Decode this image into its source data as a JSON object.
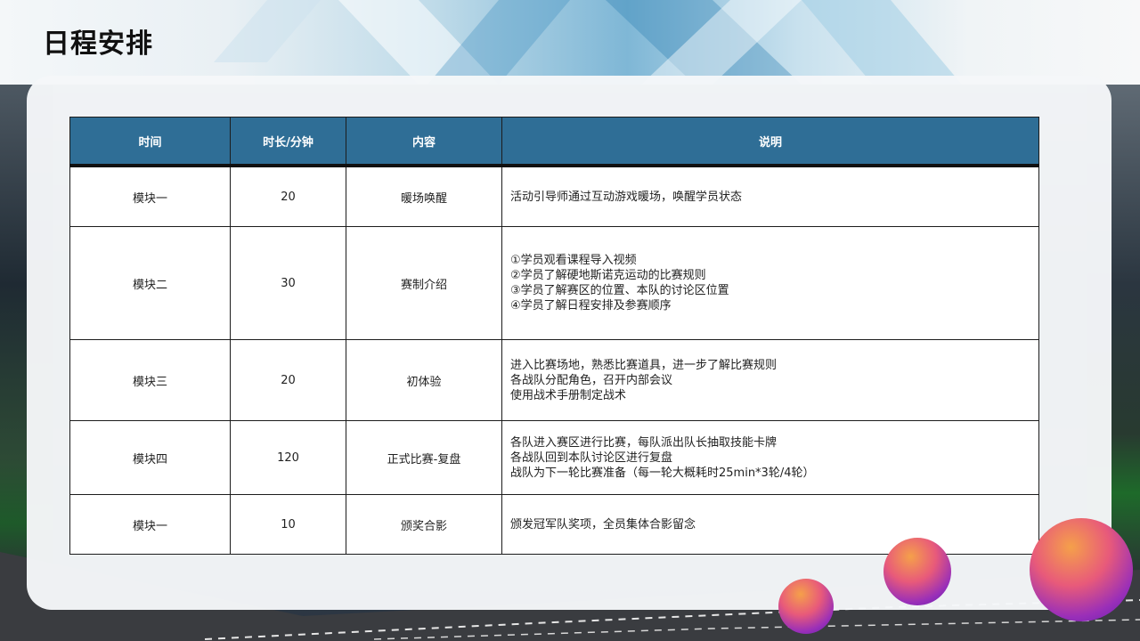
{
  "slide": {
    "title": "日程安排"
  },
  "table": {
    "headers": [
      "时间",
      "时长/分钟",
      "内容",
      "说明"
    ],
    "rows": [
      {
        "module": "模块一",
        "duration": "20",
        "content": "暖场唤醒",
        "description": [
          "活动引导师通过互动游戏暖场，唤醒学员状态"
        ]
      },
      {
        "module": "模块二",
        "duration": "30",
        "content": "赛制介绍",
        "description": [
          "①学员观看课程导入视频",
          "②学员了解硬地斯诺克运动的比赛规则",
          "③学员了解赛区的位置、本队的讨论区位置",
          "④学员了解日程安排及参赛顺序"
        ]
      },
      {
        "module": "模块三",
        "duration": "20",
        "content": "初体验",
        "description": [
          "进入比赛场地，熟悉比赛道具，进一步了解比赛规则",
          "各战队分配角色，召开内部会议",
          "使用战术手册制定战术"
        ]
      },
      {
        "module": "模块四",
        "duration": "120",
        "content": "正式比赛-复盘",
        "description": [
          "各队进入赛区进行比赛，每队派出队长抽取技能卡牌",
          "各战队回到本队讨论区进行复盘",
          "战队为下一轮比赛准备（每一轮大概耗时25min*3轮/4轮）"
        ]
      },
      {
        "module": "模块一",
        "duration": "10",
        "content": "颁奖合影",
        "description": [
          "颁发冠军队奖项，全员集体合影留念"
        ]
      }
    ]
  },
  "colors": {
    "header_bg": "#2f6e96",
    "header_text": "#ffffff",
    "border": "#1c1c1c",
    "sphere_warm": "#f5a04a",
    "sphere_cool": "#5a1fb0"
  }
}
